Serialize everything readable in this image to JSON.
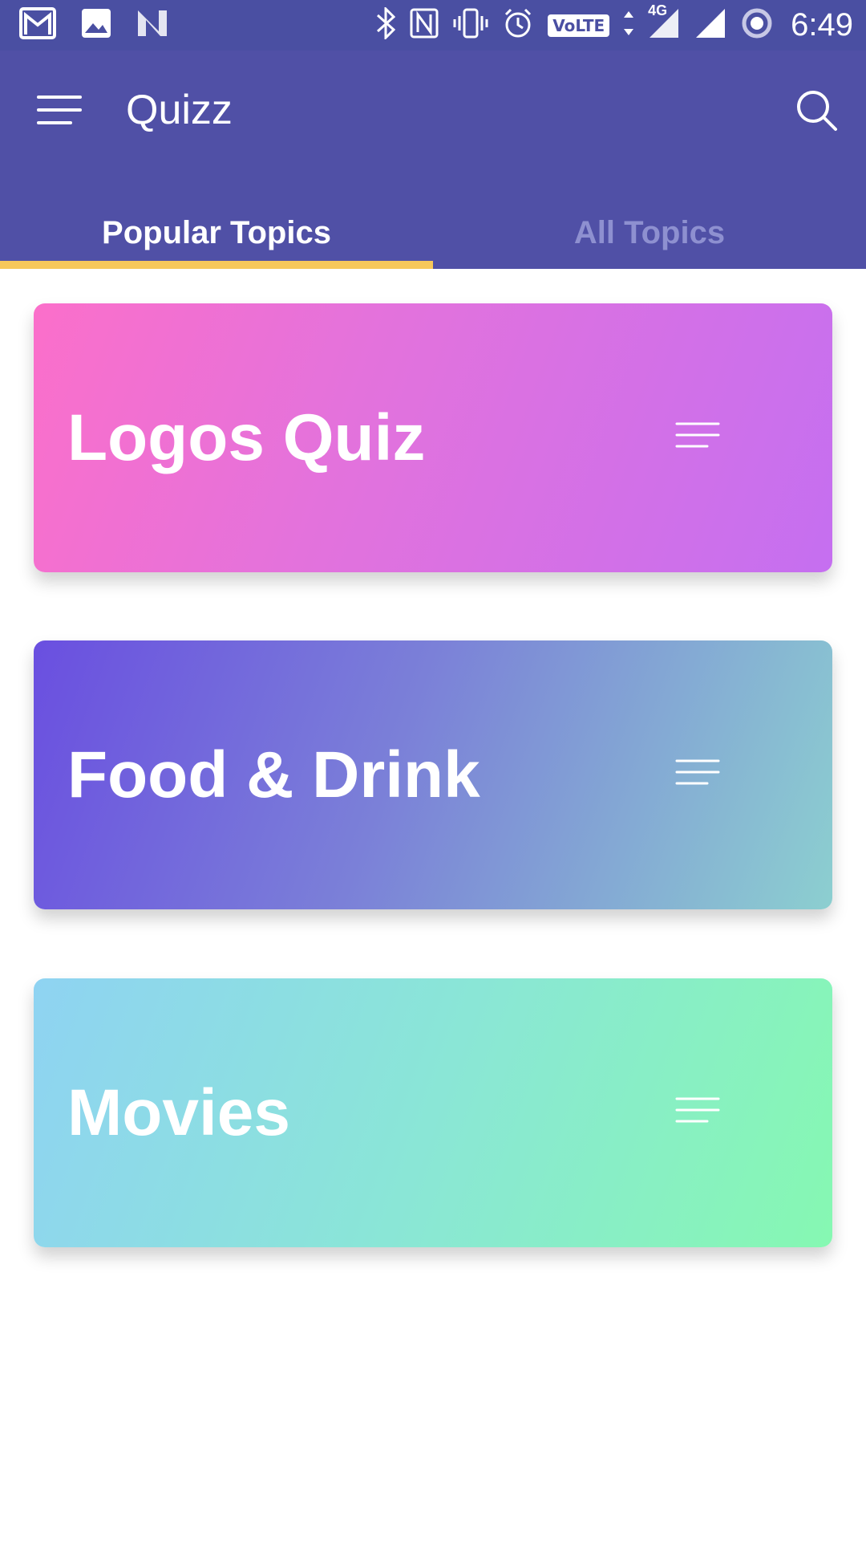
{
  "status_bar": {
    "time": "6:49",
    "network": "4G",
    "volte": "VoLTE",
    "icons_left": [
      "gmail-icon",
      "image-icon",
      "n-icon"
    ],
    "icons_right": [
      "bluetooth-icon",
      "nfc-icon",
      "vibrate-icon",
      "alarm-icon",
      "volte-icon",
      "data-arrows-icon",
      "signal-icon",
      "signal-icon",
      "sync-icon"
    ]
  },
  "app_bar": {
    "title": "Quizz",
    "menu_icon": "menu-icon",
    "search_icon": "search-icon",
    "color": "#5050a6"
  },
  "tabs": [
    {
      "label": "Popular Topics",
      "active": true
    },
    {
      "label": "All Topics",
      "active": false
    }
  ],
  "tab_indicator_color": "#f7c85b",
  "cards": [
    {
      "title": "Logos Quiz",
      "icon": "list-lines-icon",
      "gradient": [
        "#fb6fca",
        "#c56ff0"
      ]
    },
    {
      "title": "Food & Drink",
      "icon": "list-lines-icon",
      "gradient": [
        "#6a4fe0",
        "#8ccfd0"
      ]
    },
    {
      "title": "Movies",
      "icon": "list-lines-icon",
      "gradient": [
        "#8fd3f2",
        "#86f8b2"
      ]
    }
  ]
}
